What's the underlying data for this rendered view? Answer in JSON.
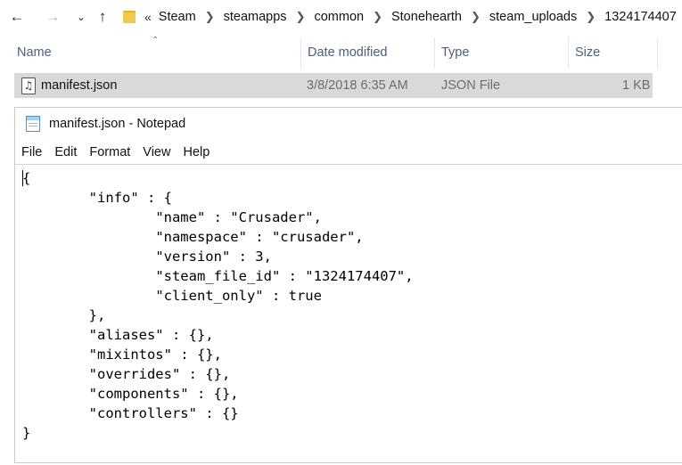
{
  "explorer": {
    "breadcrumb_overflow": "«",
    "breadcrumb": [
      "Steam",
      "steamapps",
      "common",
      "Stonehearth",
      "steam_uploads",
      "1324174407"
    ],
    "columns": {
      "name": "Name",
      "date": "Date modified",
      "type": "Type",
      "size": "Size"
    },
    "file": {
      "name": "manifest.json",
      "date": "3/8/2018 6:35 AM",
      "type": "JSON File",
      "size": "1 KB"
    }
  },
  "notepad": {
    "title": "manifest.json - Notepad",
    "menu": [
      "File",
      "Edit",
      "Format",
      "View",
      "Help"
    ],
    "content": "{\n\t\"info\" : {\n\t\t\"name\" : \"Crusader\",\n\t\t\"namespace\" : \"crusader\",\n\t\t\"version\" : 3,\n\t\t\"steam_file_id\" : \"1324174407\",\n\t\t\"client_only\" : true\n\t},\n\t\"aliases\" : {},\n\t\"mixintos\" : {},\n\t\"overrides\" : {},\n\t\"components\" : {},\n\t\"controllers\" : {}\n}"
  }
}
